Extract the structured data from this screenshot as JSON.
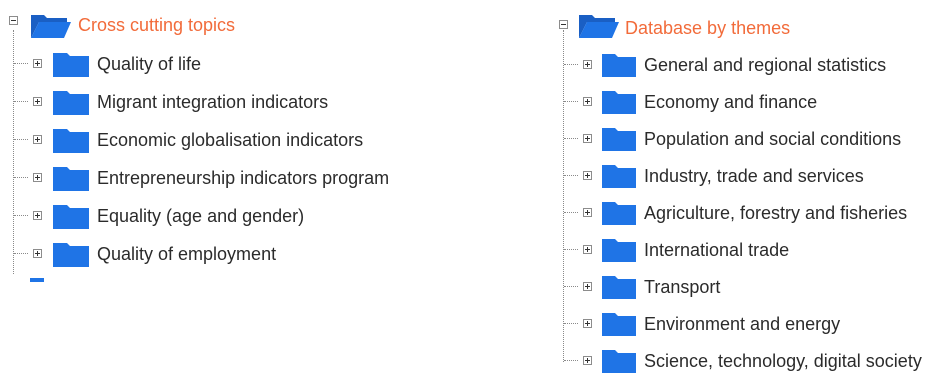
{
  "colors": {
    "folder": "#1f74e6",
    "folder_dark": "#1a5fc4",
    "root_label": "#f26b3a",
    "item_label": "#2b2b2b"
  },
  "trees": {
    "left": {
      "root_label": "Cross cutting topics",
      "items": [
        {
          "label": "Quality of life"
        },
        {
          "label": "Migrant integration indicators"
        },
        {
          "label": "Economic globalisation indicators"
        },
        {
          "label": "Entrepreneurship indicators program"
        },
        {
          "label": "Equality (age and gender)"
        },
        {
          "label": "Quality of employment"
        }
      ]
    },
    "right": {
      "root_label": "Database by themes",
      "items": [
        {
          "label": "General and regional statistics"
        },
        {
          "label": "Economy and finance"
        },
        {
          "label": "Population and social conditions"
        },
        {
          "label": "Industry, trade and services"
        },
        {
          "label": "Agriculture, forestry and fisheries"
        },
        {
          "label": "International trade"
        },
        {
          "label": "Transport"
        },
        {
          "label": "Environment and energy"
        },
        {
          "label": "Science, technology, digital society"
        }
      ]
    }
  }
}
